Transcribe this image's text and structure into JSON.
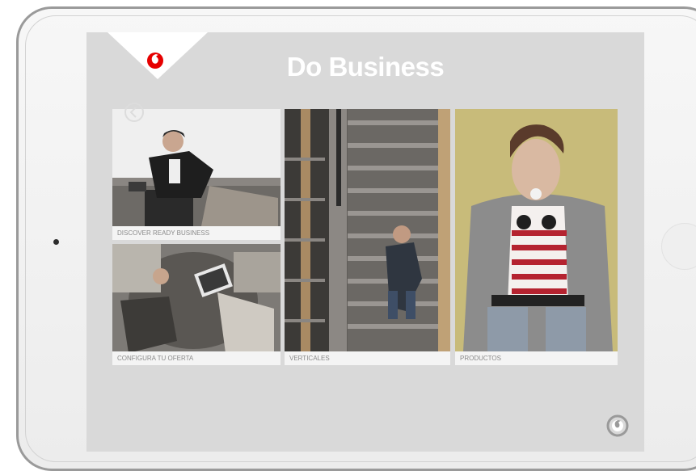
{
  "app": {
    "title": "Do Business"
  },
  "tiles": [
    {
      "id": "ready",
      "caption": "DISCOVER READY BUSINESS"
    },
    {
      "id": "configure",
      "caption": "CONFIGURA TU OFERTA"
    },
    {
      "id": "verticales",
      "caption": "VERTICALES"
    },
    {
      "id": "productos",
      "caption": "PRODUCTOS"
    }
  ],
  "colors": {
    "brand_red": "#e60000",
    "screen_bg": "#d9d9d9",
    "caption_bg": "#f4f4f4"
  },
  "icons": {
    "logo": "vodafone-logo-icon",
    "back": "back-arrow-icon",
    "corner": "vodafone-mark-icon"
  }
}
